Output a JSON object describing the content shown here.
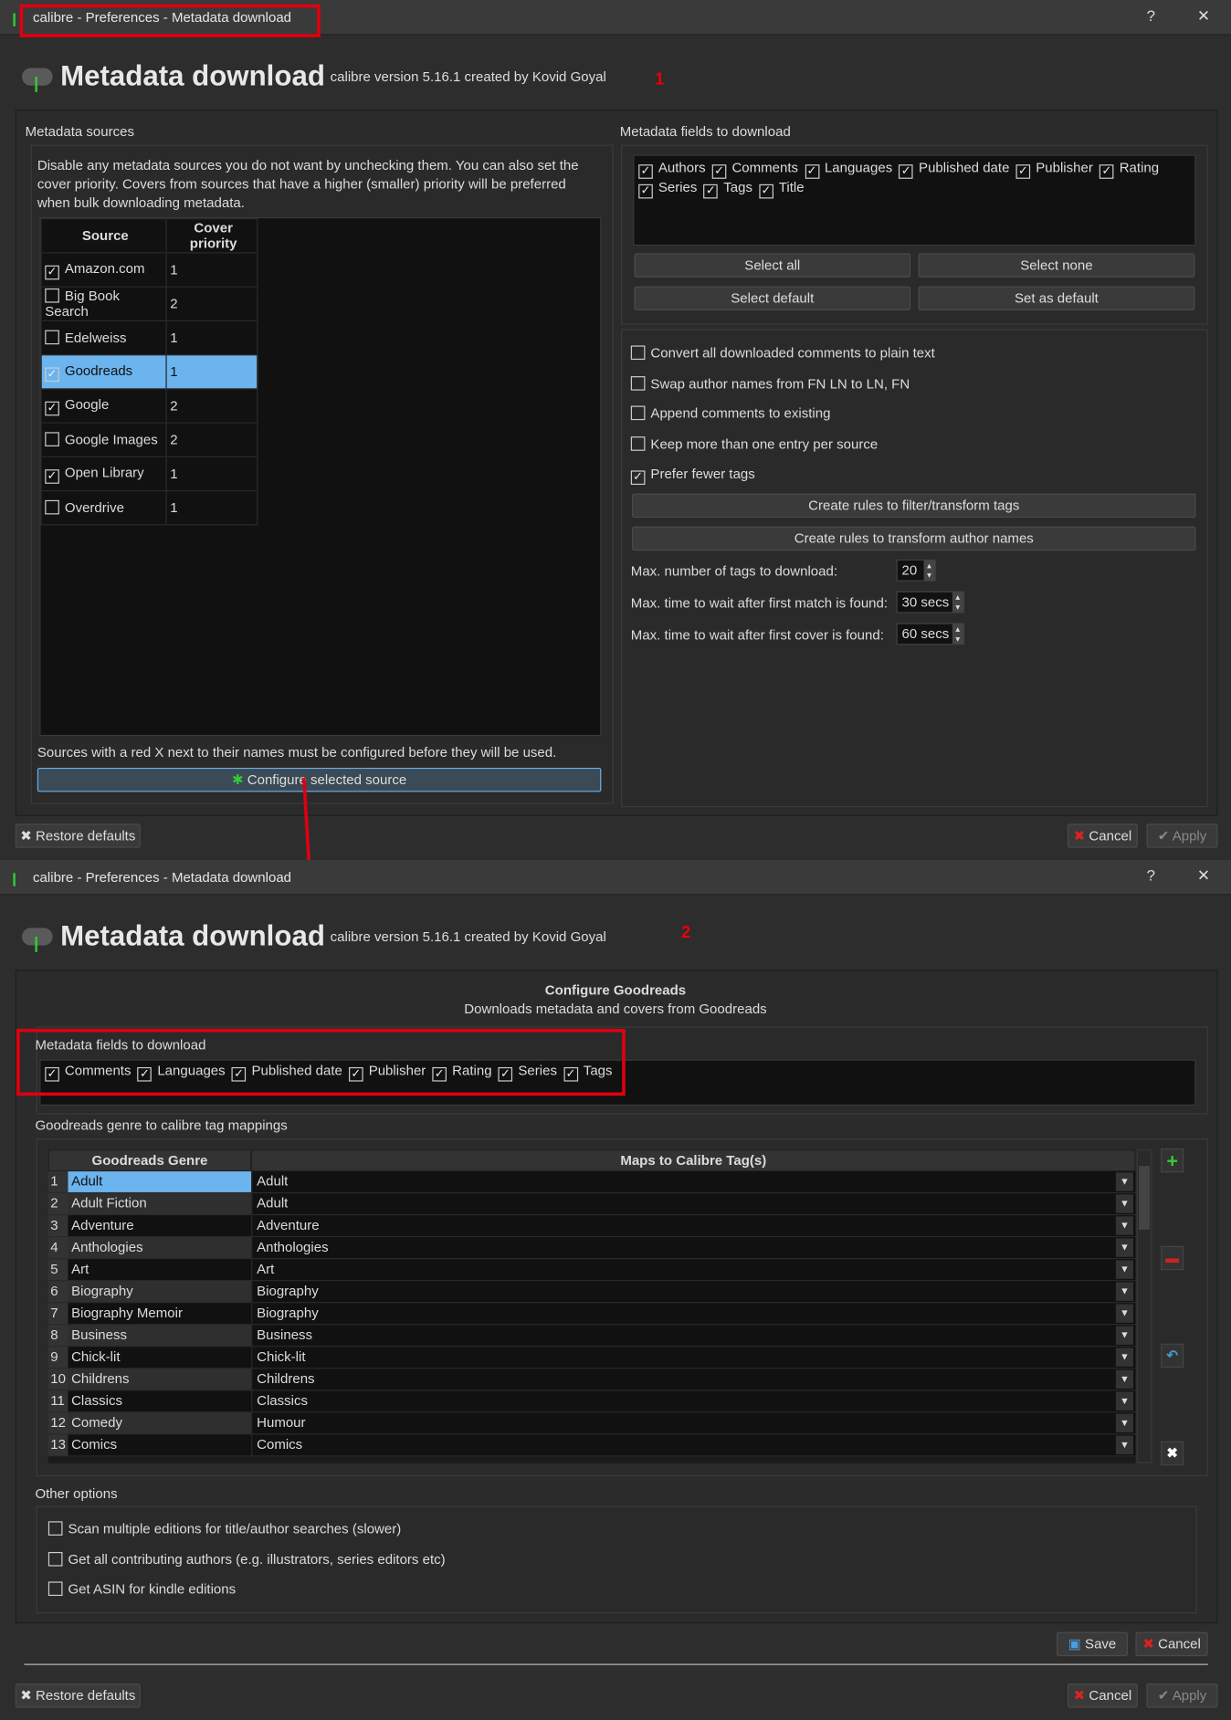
{
  "window_title": "calibre - Preferences - Metadata download",
  "header": {
    "title": "Metadata download",
    "version": "calibre version 5.16.1 created by Kovid Goyal"
  },
  "annotations": {
    "step1": "1",
    "step2": "2"
  },
  "sources": {
    "label": "Metadata sources",
    "description": "Disable any metadata sources you do not want by unchecking them. You can also set the cover priority. Covers from sources that have a higher (smaller) priority will be preferred when bulk downloading metadata.",
    "columns": [
      "Source",
      "Cover priority"
    ],
    "rows": [
      {
        "name": "Amazon.com",
        "checked": true,
        "priority": "1"
      },
      {
        "name": "Big Book Search",
        "checked": false,
        "priority": "2"
      },
      {
        "name": "Edelweiss",
        "checked": false,
        "priority": "1"
      },
      {
        "name": "Goodreads",
        "checked": true,
        "priority": "1",
        "selected": true
      },
      {
        "name": "Google",
        "checked": true,
        "priority": "2"
      },
      {
        "name": "Google Images",
        "checked": false,
        "priority": "2"
      },
      {
        "name": "Open Library",
        "checked": true,
        "priority": "1"
      },
      {
        "name": "Overdrive",
        "checked": false,
        "priority": "1"
      }
    ],
    "footnote": "Sources with a red X next to their names must be configured before they will be used.",
    "configure_button": "Configure selected source"
  },
  "fields": {
    "label": "Metadata fields to download",
    "items": [
      {
        "label": "Authors",
        "checked": true
      },
      {
        "label": "Comments",
        "checked": true
      },
      {
        "label": "Languages",
        "checked": true
      },
      {
        "label": "Published date",
        "checked": true
      },
      {
        "label": "Publisher",
        "checked": true
      },
      {
        "label": "Rating",
        "checked": true
      },
      {
        "label": "Series",
        "checked": true
      },
      {
        "label": "Tags",
        "checked": true
      },
      {
        "label": "Title",
        "checked": true
      }
    ],
    "select_all": "Select all",
    "select_none": "Select none",
    "select_default": "Select default",
    "set_default": "Set as default"
  },
  "options": {
    "checks": [
      {
        "label": "Convert all downloaded comments to plain text",
        "checked": false
      },
      {
        "label": "Swap author names from FN LN to LN, FN",
        "checked": false
      },
      {
        "label": "Append comments to existing",
        "checked": false
      },
      {
        "label": "Keep more than one entry per source",
        "checked": false
      },
      {
        "label": "Prefer fewer tags",
        "checked": true
      }
    ],
    "tag_rules_button": "Create rules to filter/transform tags",
    "author_rules_button": "Create rules to transform author names",
    "max_tags_label": "Max. number of tags to download:",
    "max_tags": "20",
    "wait_match_label": "Max. time to wait after first match is found:",
    "wait_match": "30 secs",
    "wait_cover_label": "Max. time to wait after first cover is found:",
    "wait_cover": "60 secs"
  },
  "footer": {
    "restore": "Restore defaults",
    "cancel": "Cancel",
    "apply": "Apply"
  },
  "goodreads": {
    "title": "Configure Goodreads",
    "subtitle": "Downloads metadata and covers from Goodreads",
    "fields_label": "Metadata fields to download",
    "fields": [
      {
        "label": "Comments",
        "checked": true
      },
      {
        "label": "Languages",
        "checked": true
      },
      {
        "label": "Published date",
        "checked": true
      },
      {
        "label": "Publisher",
        "checked": true
      },
      {
        "label": "Rating",
        "checked": true
      },
      {
        "label": "Series",
        "checked": true
      },
      {
        "label": "Tags",
        "checked": true
      }
    ],
    "mappings_label": "Goodreads genre to calibre tag mappings",
    "columns": [
      "Goodreads Genre",
      "Maps to Calibre Tag(s)"
    ],
    "mappings": [
      {
        "n": "1",
        "genre": "Adult",
        "tag": "Adult"
      },
      {
        "n": "2",
        "genre": "Adult Fiction",
        "tag": "Adult"
      },
      {
        "n": "3",
        "genre": "Adventure",
        "tag": "Adventure"
      },
      {
        "n": "4",
        "genre": "Anthologies",
        "tag": "Anthologies"
      },
      {
        "n": "5",
        "genre": "Art",
        "tag": "Art"
      },
      {
        "n": "6",
        "genre": "Biography",
        "tag": "Biography"
      },
      {
        "n": "7",
        "genre": "Biography Memoir",
        "tag": "Biography"
      },
      {
        "n": "8",
        "genre": "Business",
        "tag": "Business"
      },
      {
        "n": "9",
        "genre": "Chick-lit",
        "tag": "Chick-lit"
      },
      {
        "n": "10",
        "genre": "Childrens",
        "tag": "Childrens"
      },
      {
        "n": "11",
        "genre": "Classics",
        "tag": "Classics"
      },
      {
        "n": "12",
        "genre": "Comedy",
        "tag": "Humour"
      },
      {
        "n": "13",
        "genre": "Comics",
        "tag": "Comics"
      }
    ],
    "other_label": "Other options",
    "other": [
      {
        "label": "Scan multiple editions for title/author searches (slower)",
        "checked": false
      },
      {
        "label": "Get all contributing authors (e.g. illustrators, series editors etc)",
        "checked": false
      },
      {
        "label": "Get ASIN for kindle editions",
        "checked": false
      }
    ],
    "save": "Save",
    "cancel": "Cancel"
  },
  "colors": {
    "selection": "#6cb4ee",
    "annotation": "#e0000f"
  }
}
